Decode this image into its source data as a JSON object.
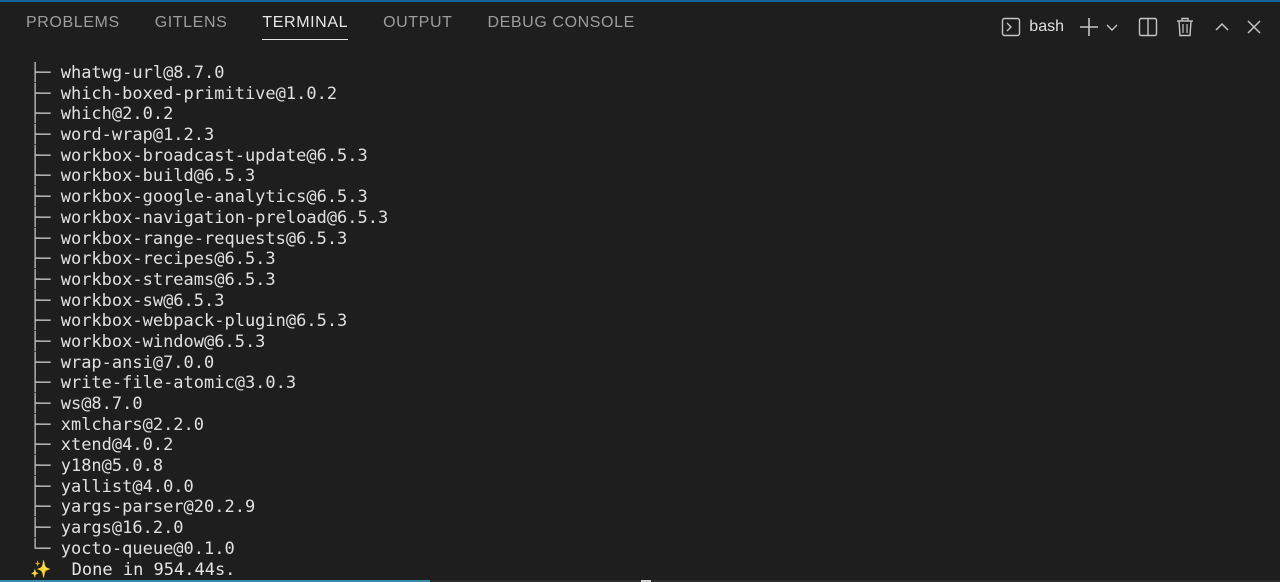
{
  "panel": {
    "tabs": [
      {
        "label": "PROBLEMS"
      },
      {
        "label": "GITLENS"
      },
      {
        "label": "TERMINAL"
      },
      {
        "label": "OUTPUT"
      },
      {
        "label": "DEBUG CONSOLE"
      }
    ],
    "active_tab": "TERMINAL",
    "terminal_name": "bash"
  },
  "terminal": {
    "tree_branch": "├─",
    "tree_last": "└─",
    "packages": [
      "whatwg-url@8.7.0",
      "which-boxed-primitive@1.0.2",
      "which@2.0.2",
      "word-wrap@1.2.3",
      "workbox-broadcast-update@6.5.3",
      "workbox-build@6.5.3",
      "workbox-google-analytics@6.5.3",
      "workbox-navigation-preload@6.5.3",
      "workbox-range-requests@6.5.3",
      "workbox-recipes@6.5.3",
      "workbox-streams@6.5.3",
      "workbox-sw@6.5.3",
      "workbox-webpack-plugin@6.5.3",
      "workbox-window@6.5.3",
      "wrap-ansi@7.0.0",
      "write-file-atomic@3.0.3",
      "ws@8.7.0",
      "xmlchars@2.2.0",
      "xtend@4.0.2",
      "y18n@5.0.8",
      "yallist@4.0.0",
      "yargs-parser@20.2.9",
      "yargs@16.2.0",
      "yocto-queue@0.1.0"
    ],
    "done_icon": "✨",
    "done_text": "Done in 954.44s."
  },
  "icons": {
    "terminal": "terminal-icon",
    "new": "plus-icon",
    "dropdown": "chevron-down-icon",
    "split": "split-icon",
    "trash": "trash-icon",
    "maximize": "chevron-up-icon",
    "close": "close-icon"
  },
  "colors": {
    "background": "#1e1e1e",
    "accent": "#0e639c",
    "text": "#e0e0e0",
    "tab_inactive": "#9d9d9d"
  }
}
